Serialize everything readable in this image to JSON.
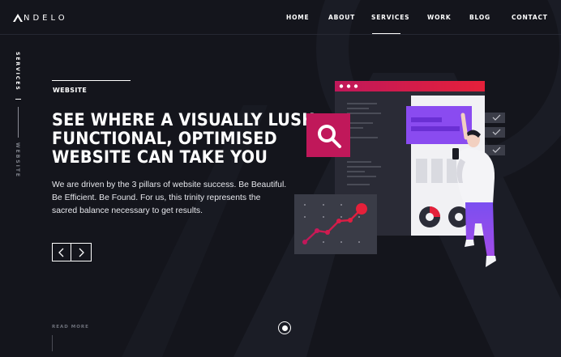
{
  "brand": {
    "logo_text": "NDELO"
  },
  "nav": {
    "items": [
      {
        "label": "HOME",
        "active": false
      },
      {
        "label": "ABOUT",
        "active": false
      },
      {
        "label": "SERVICES",
        "active": true
      },
      {
        "label": "WORK",
        "active": false
      },
      {
        "label": "BLOG",
        "active": false
      },
      {
        "label": "CONTACT",
        "active": false
      }
    ]
  },
  "rail": {
    "primary": "SERVICES",
    "secondary": "WEBSITE"
  },
  "hero": {
    "eyebrow": "WEBSITE",
    "headline_lines": [
      "SEE WHERE A VISUALLY LUSH,",
      "FUNCTIONAL, OPTIMISED",
      "WEBSITE CAN TAKE YOU"
    ],
    "body": "We are driven by the 3 pillars of website success. Be Beautiful. Be Efficient. Be Found. For us, this trinity represents the sacred balance necessary to get results.",
    "read_more": "READ MORE"
  },
  "icons": {
    "prev": "chevron-left-icon",
    "next": "chevron-right-icon",
    "search": "search-icon",
    "check": "check-icon"
  },
  "colors": {
    "background": "#14151c",
    "accent_red": "#e5203a",
    "accent_magenta": "#c0185a",
    "accent_purple": "#8a4bf0",
    "text": "#ffffff"
  }
}
